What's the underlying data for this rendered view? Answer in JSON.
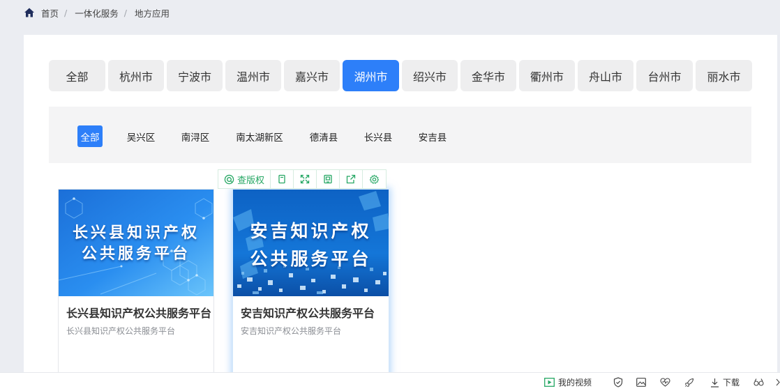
{
  "breadcrumb": {
    "home": "首页",
    "level2": "一体化服务",
    "level3": "地方应用"
  },
  "city_tabs": [
    "全部",
    "杭州市",
    "宁波市",
    "温州市",
    "嘉兴市",
    "湖州市",
    "绍兴市",
    "金华市",
    "衢州市",
    "舟山市",
    "台州市",
    "丽水市"
  ],
  "city_active": "湖州市",
  "districts": [
    "全部",
    "吴兴区",
    "南浔区",
    "南太湖新区",
    "德清县",
    "长兴县",
    "安吉县"
  ],
  "district_active": "全部",
  "cards": [
    {
      "thumb_line1": "长兴县知识产权",
      "thumb_line2": "公共服务平台",
      "title": "长兴县知识产权公共服务平台",
      "desc": "长兴县知识产权公共服务平台"
    },
    {
      "thumb_line1": "安吉知识产权",
      "thumb_line2": "公共服务平台",
      "title": "安吉知识产权公共服务平台",
      "desc": "安吉知识产权公共服务平台"
    }
  ],
  "float_toolbar": {
    "copyright_label": "查版权"
  },
  "statusbar": {
    "my_video": "我的视频",
    "download": "下载"
  },
  "colors": {
    "accent": "#2d7ff9",
    "toolbar_green": "#26a764"
  }
}
